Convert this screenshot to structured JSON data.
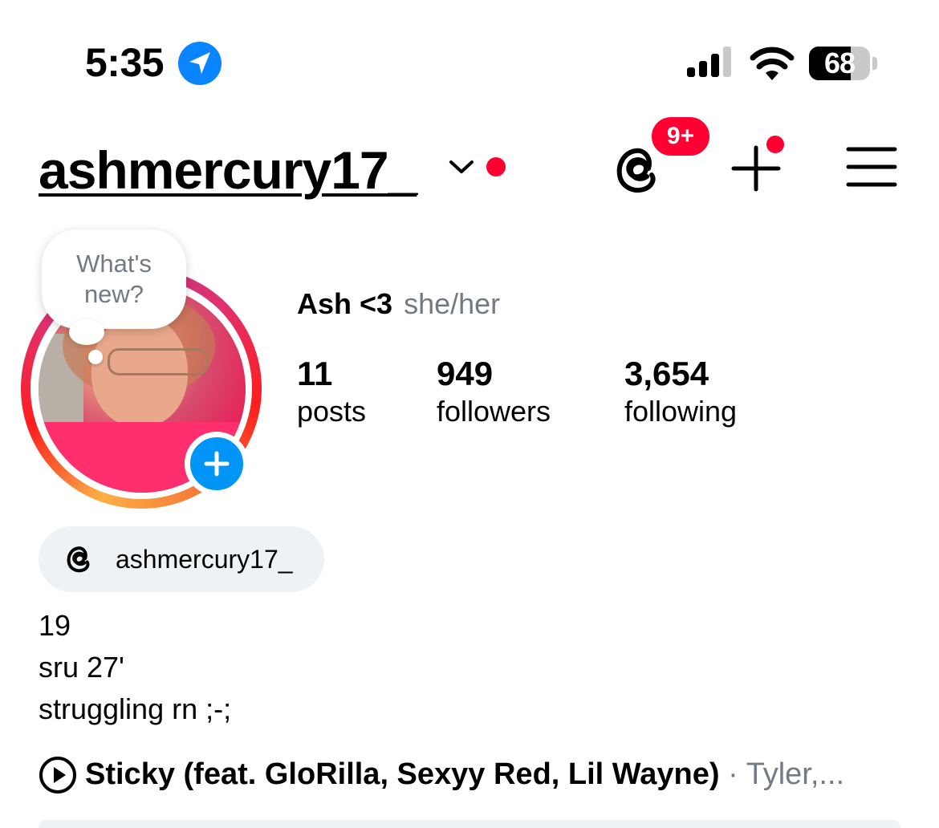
{
  "status_bar": {
    "time": "5:35",
    "battery_percent": "68",
    "battery_level": 0.68
  },
  "header": {
    "username": "ashmercury17_",
    "threads_badge": "9+"
  },
  "story_prompt": {
    "line1": "What's",
    "line2": "new?"
  },
  "profile": {
    "name": "Ash <3",
    "pronouns": "she/her"
  },
  "stats": [
    {
      "value": "11",
      "label": "posts"
    },
    {
      "value": "949",
      "label": "followers"
    },
    {
      "value": "3,654",
      "label": "following"
    }
  ],
  "threads_chip": {
    "handle": "ashmercury17_"
  },
  "bio": [
    "19",
    "sru 27'",
    "struggling rn ;-;"
  ],
  "music": {
    "song": "Sticky (feat. GloRilla, Sexyy Red, Lil Wayne)",
    "artist": "· Tyler,..."
  },
  "colors": {
    "accent_blue": "#0095f6",
    "notification_red": "#ff0033",
    "secondary_text": "#737a83",
    "chip_background": "#eff2f5"
  },
  "icons": [
    "location-arrow-icon",
    "cellular-signal-icon",
    "wifi-icon",
    "battery-icon",
    "chevron-down-icon",
    "threads-icon",
    "plus-icon",
    "hamburger-menu-icon",
    "add-story-icon",
    "play-icon"
  ]
}
